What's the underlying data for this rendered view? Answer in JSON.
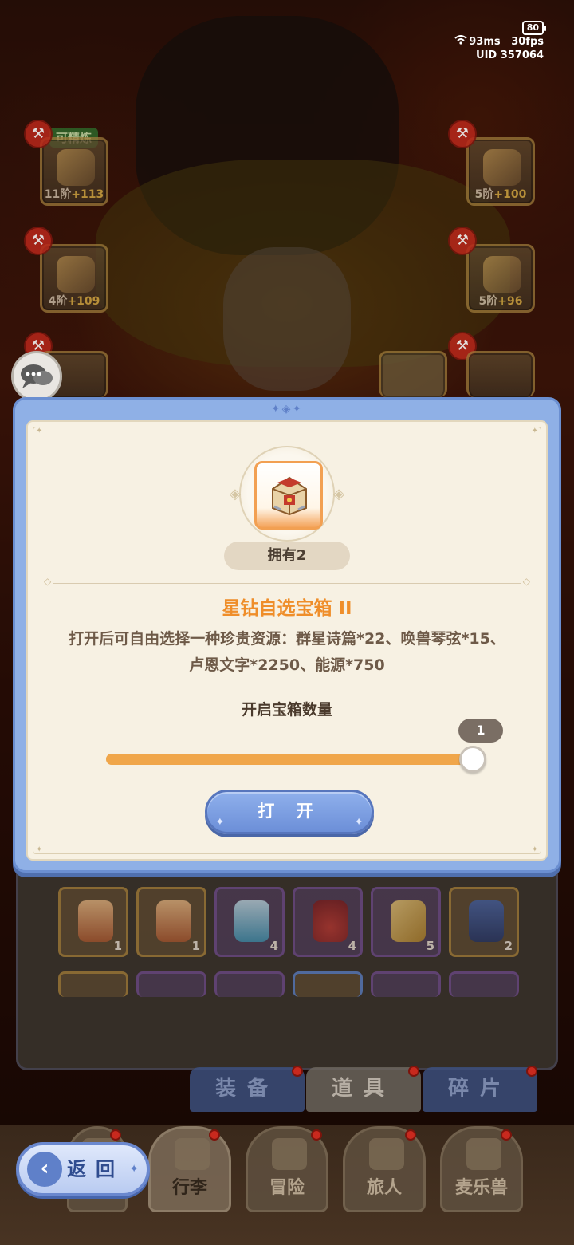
{
  "status": {
    "battery": "80",
    "ping": "93ms",
    "fps": "30fps",
    "uid": "UID 357064"
  },
  "equipment": {
    "refine_tag": "可精炼",
    "slots": [
      {
        "tier": "11阶",
        "bonus": "+113"
      },
      {
        "tier": "4阶",
        "bonus": "+109"
      },
      {
        "tier": "5阶",
        "bonus": "+100"
      },
      {
        "tier": "5阶",
        "bonus": "+96"
      }
    ]
  },
  "modal": {
    "owned": "拥有2",
    "item_name": "星钻自选宝箱 II",
    "item_desc": "打开后可自由选择一种珍贵资源：群星诗篇*22、唤兽琴弦*15、卢恩文字*2250、能源*750",
    "quantity_label": "开启宝箱数量",
    "quantity_value": "1",
    "slider_fraction": 1.0,
    "open_button": "打 开"
  },
  "inventory": {
    "row1_counts": [
      "1",
      "1",
      "4",
      "4",
      "5",
      "2"
    ]
  },
  "category_tabs": [
    {
      "label": "装备",
      "active": false
    },
    {
      "label": "道具",
      "active": true
    },
    {
      "label": "碎片",
      "active": false
    }
  ],
  "nav": {
    "back": "返回",
    "items": [
      {
        "label": "行李",
        "active": true
      },
      {
        "label": "冒险",
        "active": false
      },
      {
        "label": "旅人",
        "active": false
      },
      {
        "label": "麦乐兽",
        "active": false
      }
    ]
  },
  "colors": {
    "accent_orange": "#ef8e2a",
    "modal_blue": "#8fb0e6",
    "panel_cream": "#f7f1e3"
  }
}
